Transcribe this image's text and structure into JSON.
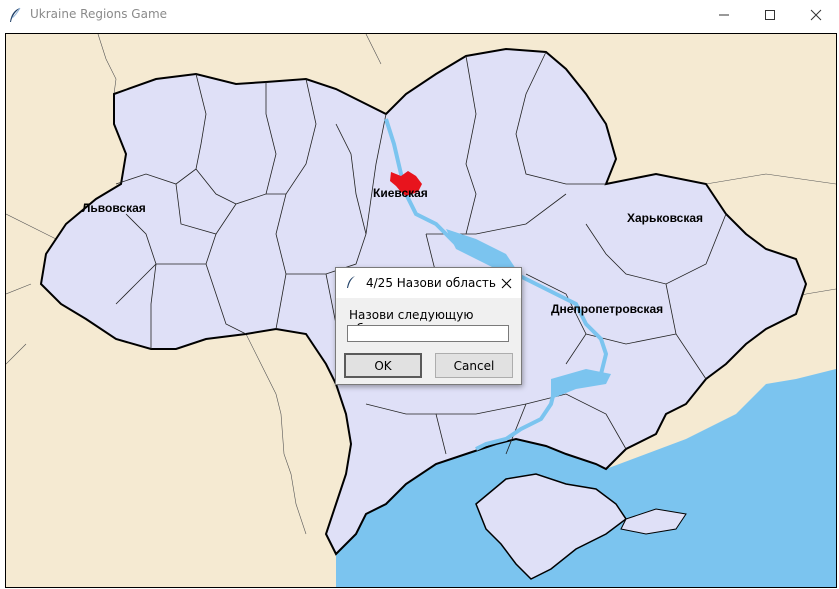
{
  "window": {
    "title": "Ukraine Regions Game",
    "icon": "feather-icon",
    "controls": [
      "minimize-icon",
      "maximize-icon",
      "close-icon"
    ]
  },
  "map": {
    "colors": {
      "land": "#dfe0f7",
      "foreign_land": "#f5ead2",
      "sea": "#7bc4ef",
      "river": "#7bc4ef",
      "highlight": "#e8141d",
      "border": "#000000"
    },
    "labels": {
      "lviv": "Львовская",
      "kyiv": "Киевская",
      "kharkiv": "Харьковская",
      "dnipro": "Днепропетровская"
    },
    "highlighted_region": "Киевская"
  },
  "dialog": {
    "title": "4/25 Назови область",
    "prompt": "Назови следующую область",
    "input_value": "",
    "ok_label": "OK",
    "cancel_label": "Cancel"
  }
}
